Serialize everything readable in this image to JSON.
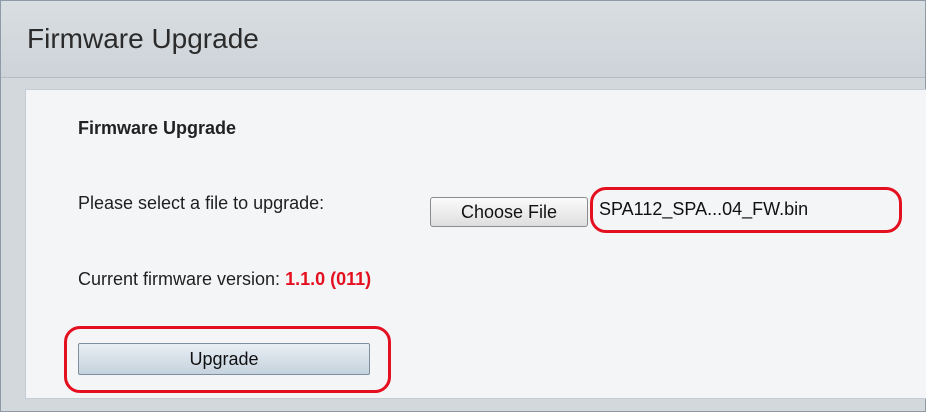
{
  "header": {
    "title": "Firmware Upgrade"
  },
  "section": {
    "title": "Firmware Upgrade",
    "file_label": "Please select a file to upgrade:",
    "choose_file_label": "Choose File",
    "selected_file": "SPA112_SPA...04_FW.bin",
    "version_label": "Current firmware version:",
    "version_value": "1.1.0 (011)",
    "upgrade_label": "Upgrade"
  },
  "colors": {
    "highlight": "#e5101f",
    "version_value": "#e5101f",
    "frame_background": "#d3d8dd",
    "panel_background": "#f3f5f7"
  }
}
